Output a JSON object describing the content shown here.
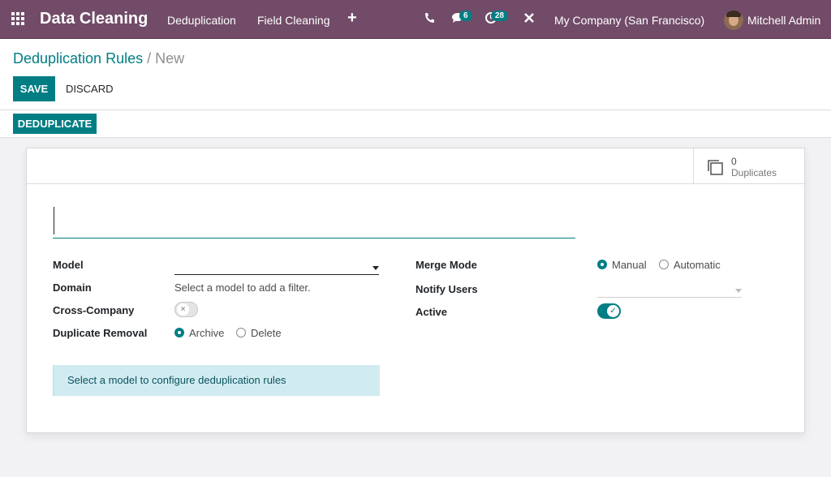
{
  "navbar": {
    "app_name": "Data Cleaning",
    "menu": [
      "Deduplication",
      "Field Cleaning"
    ],
    "messages_count": "6",
    "activities_count": "28",
    "company": "My Company (San Francisco)",
    "user": "Mitchell Admin"
  },
  "breadcrumb": {
    "parent": "Deduplication Rules",
    "separator": "/",
    "current": "New"
  },
  "actions": {
    "save": "SAVE",
    "discard": "DISCARD",
    "deduplicate": "DEDUPLICATE"
  },
  "stat_button": {
    "count": "0",
    "label": "Duplicates"
  },
  "form": {
    "name_value": "",
    "model_label": "Model",
    "model_value": "",
    "domain_label": "Domain",
    "domain_value": "Select a model to add a filter.",
    "cross_company_label": "Cross-Company",
    "cross_company_on": false,
    "duplicate_removal_label": "Duplicate Removal",
    "duplicate_removal_options": [
      "Archive",
      "Delete"
    ],
    "duplicate_removal_selected": "Archive",
    "merge_mode_label": "Merge Mode",
    "merge_mode_options": [
      "Manual",
      "Automatic"
    ],
    "merge_mode_selected": "Manual",
    "notify_users_label": "Notify Users",
    "notify_users_value": "",
    "active_label": "Active",
    "active_on": true,
    "info_message": "Select a model to configure deduplication rules"
  },
  "colors": {
    "navbar": "#714b67",
    "primary": "#017e84",
    "info_bg": "#d1ecf1",
    "info_text": "#0c5460"
  }
}
